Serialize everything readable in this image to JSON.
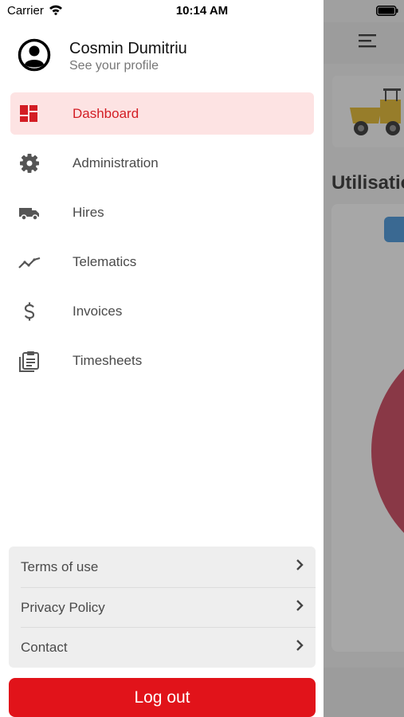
{
  "status_bar": {
    "carrier": "Carrier",
    "time": "10:14 AM"
  },
  "profile": {
    "name": "Cosmin Dumitriu",
    "subtitle": "See your profile",
    "icon": "user-circle-icon"
  },
  "menu": {
    "active_index": 0,
    "accent_color": "#d31d24",
    "items": [
      {
        "label": "Dashboard",
        "icon": "dashboard-icon"
      },
      {
        "label": "Administration",
        "icon": "gear-icon"
      },
      {
        "label": "Hires",
        "icon": "truck-icon"
      },
      {
        "label": "Telematics",
        "icon": "trend-line-icon"
      },
      {
        "label": "Invoices",
        "icon": "dollar-icon"
      },
      {
        "label": "Timesheets",
        "icon": "clipboard-icon"
      }
    ]
  },
  "links": [
    {
      "label": "Terms of use",
      "icon": "chevron-right-icon"
    },
    {
      "label": "Privacy Policy",
      "icon": "chevron-right-icon"
    },
    {
      "label": "Contact",
      "icon": "chevron-right-icon"
    }
  ],
  "logout": {
    "label": "Log out",
    "color": "#e1131a"
  },
  "background_screen": {
    "title": "Utilisatio"
  }
}
